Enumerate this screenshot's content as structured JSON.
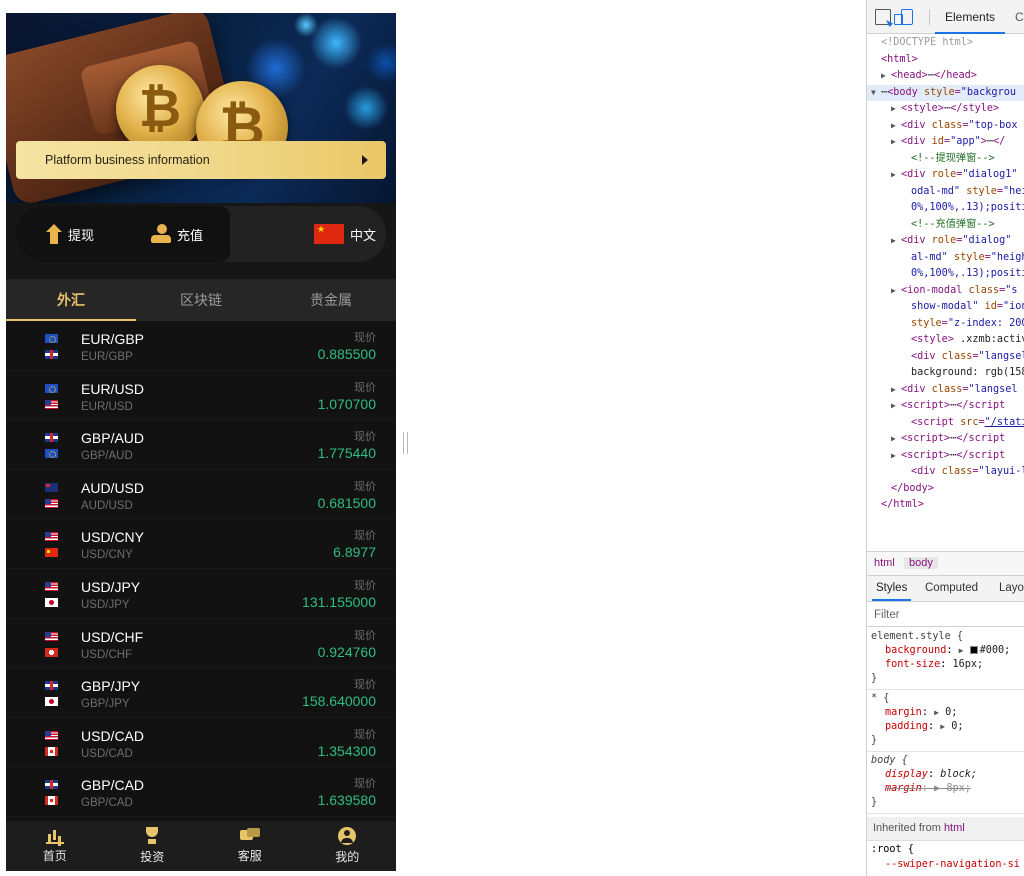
{
  "app": {
    "promo_text": "Platform business information",
    "actions": {
      "withdraw": "提现",
      "recharge": "充值",
      "language": "中文"
    },
    "tabs": [
      {
        "label": "外汇",
        "active": true
      },
      {
        "label": "区块链",
        "active": false
      },
      {
        "label": "贵金属",
        "active": false
      }
    ],
    "price_label": "现价",
    "pairs": [
      {
        "name": "EUR/GBP",
        "sub": "EUR/GBP",
        "price": "0.885500",
        "flag1": "eu",
        "flag2": "uk"
      },
      {
        "name": "EUR/USD",
        "sub": "EUR/USD",
        "price": "1.070700",
        "flag1": "eu",
        "flag2": "us"
      },
      {
        "name": "GBP/AUD",
        "sub": "GBP/AUD",
        "price": "1.775440",
        "flag1": "uk",
        "flag2": "eu"
      },
      {
        "name": "AUD/USD",
        "sub": "AUD/USD",
        "price": "0.681500",
        "flag1": "au",
        "flag2": "us"
      },
      {
        "name": "USD/CNY",
        "sub": "USD/CNY",
        "price": "6.8977",
        "flag1": "us",
        "flag2": "cn"
      },
      {
        "name": "USD/JPY",
        "sub": "USD/JPY",
        "price": "131.155000",
        "flag1": "us",
        "flag2": "jp"
      },
      {
        "name": "USD/CHF",
        "sub": "USD/CHF",
        "price": "0.924760",
        "flag1": "us",
        "flag2": "ch"
      },
      {
        "name": "GBP/JPY",
        "sub": "GBP/JPY",
        "price": "158.640000",
        "flag1": "uk",
        "flag2": "jp"
      },
      {
        "name": "USD/CAD",
        "sub": "USD/CAD",
        "price": "1.354300",
        "flag1": "us",
        "flag2": "ca"
      },
      {
        "name": "GBP/CAD",
        "sub": "GBP/CAD",
        "price": "1.639580",
        "flag1": "uk",
        "flag2": "ca"
      }
    ],
    "bottom_nav": [
      {
        "label": "首页",
        "icon": "home-chart-icon"
      },
      {
        "label": "投资",
        "icon": "trophy-icon"
      },
      {
        "label": "客服",
        "icon": "chat-icon"
      },
      {
        "label": "我的",
        "icon": "user-icon"
      }
    ],
    "colors": {
      "accent_gold": "#e7c46a",
      "price_green": "#2ebd85",
      "background": "#111111"
    }
  },
  "devtools": {
    "tabs": {
      "elements": "Elements",
      "console": "Co"
    },
    "dom_lines": [
      {
        "indent": 0,
        "tri": "",
        "html": "<span class='t-doc'>&lt;!DOCTYPE html&gt;</span>"
      },
      {
        "indent": 0,
        "tri": "",
        "html": "<span class='t-tag'>&lt;html&gt;</span>"
      },
      {
        "indent": 1,
        "tri": "▶",
        "html": "<span class='t-tag'>&lt;head&gt;</span><span class='t-plain'>⋯</span><span class='t-tag'>&lt;/head&gt;</span>"
      },
      {
        "indent": 0,
        "tri": "▼",
        "sel": true,
        "html": "<span class='t-plain'>⋯</span><span class='t-tag'>&lt;body </span><span class='t-attr'>style</span><span class='t-tag'>=</span><span class='t-val'>\"backgrou</span>"
      },
      {
        "indent": 2,
        "tri": "▶",
        "html": "<span class='t-tag'>&lt;style&gt;</span><span class='t-plain'>⋯</span><span class='t-tag'>&lt;/style&gt;</span>"
      },
      {
        "indent": 2,
        "tri": "▶",
        "html": "<span class='t-tag'>&lt;div </span><span class='t-attr'>class</span><span class='t-tag'>=</span><span class='t-val'>\"top-box</span>"
      },
      {
        "indent": 2,
        "tri": "▶",
        "html": "<span class='t-tag'>&lt;div </span><span class='t-attr'>id</span><span class='t-tag'>=</span><span class='t-val'>\"app\"</span><span class='t-tag'>&gt;</span><span class='t-plain'>⋯</span><span class='t-tag'>&lt;/</span>"
      },
      {
        "indent": 3,
        "tri": "",
        "html": "<span class='t-comment'>&lt;!--提现弹窗--&gt;</span>"
      },
      {
        "indent": 2,
        "tri": "▶",
        "html": "<span class='t-tag'>&lt;div </span><span class='t-attr'>role</span><span class='t-tag'>=</span><span class='t-val'>\"dialog1\"</span>"
      },
      {
        "indent": 3,
        "tri": "",
        "html": "<span class='t-val'>odal-md\" </span><span class='t-attr'>style</span><span class='t-tag'>=</span><span class='t-val'>\"hei</span>"
      },
      {
        "indent": 3,
        "tri": "",
        "html": "<span class='t-val'>0%,100%,.13);positi</span>"
      },
      {
        "indent": 3,
        "tri": "",
        "html": "<span class='t-comment'>&lt;!--充值弹窗--&gt;</span>"
      },
      {
        "indent": 2,
        "tri": "▶",
        "html": "<span class='t-tag'>&lt;div </span><span class='t-attr'>role</span><span class='t-tag'>=</span><span class='t-val'>\"dialog\"</span>"
      },
      {
        "indent": 3,
        "tri": "",
        "html": "<span class='t-val'>al-md\" </span><span class='t-attr'>style</span><span class='t-tag'>=</span><span class='t-val'>\"heigh</span>"
      },
      {
        "indent": 3,
        "tri": "",
        "html": "<span class='t-val'>0%,100%,.13);positi</span>"
      },
      {
        "indent": 2,
        "tri": "▶",
        "html": "<span class='t-tag'>&lt;ion-modal </span><span class='t-attr'>class</span><span class='t-tag'>=</span><span class='t-val'>\"s</span>"
      },
      {
        "indent": 3,
        "tri": "",
        "html": "<span class='t-val'>show-modal\" </span><span class='t-attr'>id</span><span class='t-tag'>=</span><span class='t-val'>\"ion</span>"
      },
      {
        "indent": 3,
        "tri": "",
        "html": "<span class='t-attr'>style</span><span class='t-tag'>=</span><span class='t-val'>\"z-index: 200</span>"
      },
      {
        "indent": 3,
        "tri": "",
        "html": "<span class='t-tag'>&lt;style&gt;</span><span class='t-plain'> .xzmb:activ</span>"
      },
      {
        "indent": 3,
        "tri": "",
        "html": "<span class='t-tag'>&lt;div </span><span class='t-attr'>class</span><span class='t-tag'>=</span><span class='t-val'>\"langsel</span>"
      },
      {
        "indent": 3,
        "tri": "",
        "html": "<span class='t-plain'>background: rgb(158</span>"
      },
      {
        "indent": 2,
        "tri": "▶",
        "html": "<span class='t-tag'>&lt;div </span><span class='t-attr'>class</span><span class='t-tag'>=</span><span class='t-val'>\"langsel</span>"
      },
      {
        "indent": 2,
        "tri": "▶",
        "html": "<span class='t-tag'>&lt;script&gt;</span><span class='t-plain'>⋯</span><span class='t-tag'>&lt;/script</span>"
      },
      {
        "indent": 3,
        "tri": "",
        "html": "<span class='t-tag'>&lt;script </span><span class='t-attr'>src</span><span class='t-tag'>=</span><span class='t-link'>\"/stati</span>"
      },
      {
        "indent": 2,
        "tri": "▶",
        "html": "<span class='t-tag'>&lt;script&gt;</span><span class='t-plain'>⋯</span><span class='t-tag'>&lt;/script</span>"
      },
      {
        "indent": 2,
        "tri": "▶",
        "html": "<span class='t-tag'>&lt;script&gt;</span><span class='t-plain'>⋯</span><span class='t-tag'>&lt;/script</span>"
      },
      {
        "indent": 3,
        "tri": "",
        "html": "<span class='t-tag'>&lt;div </span><span class='t-attr'>class</span><span class='t-tag'>=</span><span class='t-val'>\"layui-l</span>"
      },
      {
        "indent": 1,
        "tri": "",
        "html": "<span class='t-tag'>&lt;/body&gt;</span>"
      },
      {
        "indent": 0,
        "tri": "",
        "html": "<span class='t-tag'>&lt;/html&gt;</span>"
      }
    ],
    "breadcrumbs": {
      "html": "html",
      "body": "body"
    },
    "style_tabs": {
      "styles": "Styles",
      "computed": "Computed",
      "layout": "Layou"
    },
    "filter_placeholder": "Filter",
    "inherited_label": "Inherited from",
    "inherited_tag": "html",
    "root_selector": ":root {",
    "root_decl": "--swiper-navigation-si"
  }
}
